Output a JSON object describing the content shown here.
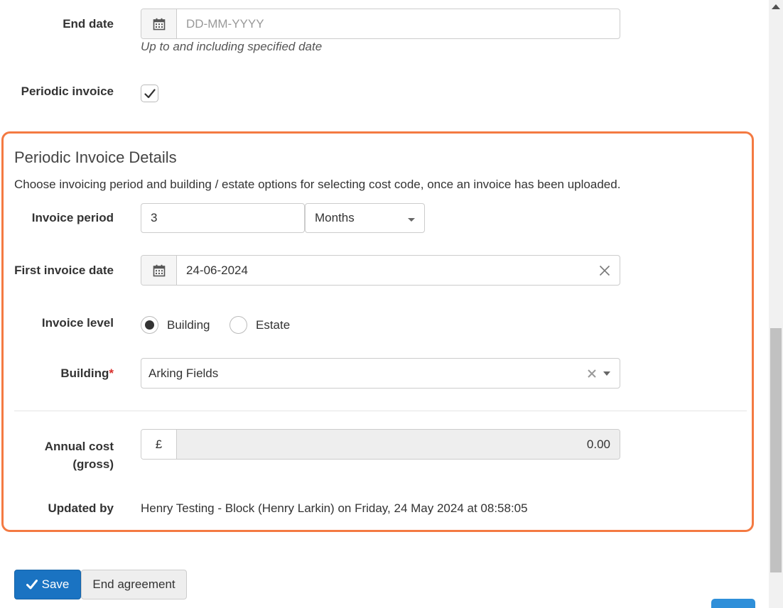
{
  "end_date": {
    "label": "End date",
    "placeholder": "DD-MM-YYYY",
    "help": "Up to and including specified date",
    "icon": "calendar-icon"
  },
  "periodic_invoice": {
    "label": "Periodic invoice",
    "checked": true,
    "icon": "check-icon"
  },
  "details": {
    "title": "Periodic Invoice Details",
    "description": "Choose invoicing period and building / estate options for selecting cost code, once an invoice has been uploaded.",
    "invoice_period": {
      "label": "Invoice period",
      "value": "3",
      "unit": "Months"
    },
    "first_invoice_date": {
      "label": "First invoice date",
      "value": "24-06-2024",
      "icon": "calendar-icon",
      "clear_icon": "close-icon"
    },
    "invoice_level": {
      "label": "Invoice level",
      "options": [
        "Building",
        "Estate"
      ],
      "selected": "Building"
    },
    "building": {
      "label": "Building",
      "required_mark": "*",
      "value": "Arking Fields"
    },
    "annual_cost": {
      "label_line1": "Annual cost",
      "label_line2": "(gross)",
      "currency": "£",
      "value": "0.00"
    },
    "updated_by": {
      "label": "Updated by",
      "value": "Henry Testing - Block (Henry Larkin) on Friday, 24 May 2024 at 08:58:05"
    }
  },
  "actions": {
    "save_label": "Save",
    "end_agreement_label": "End agreement"
  },
  "colors": {
    "panel_border": "#f47a42",
    "primary": "#1a73c2",
    "required": "#d9302c"
  }
}
